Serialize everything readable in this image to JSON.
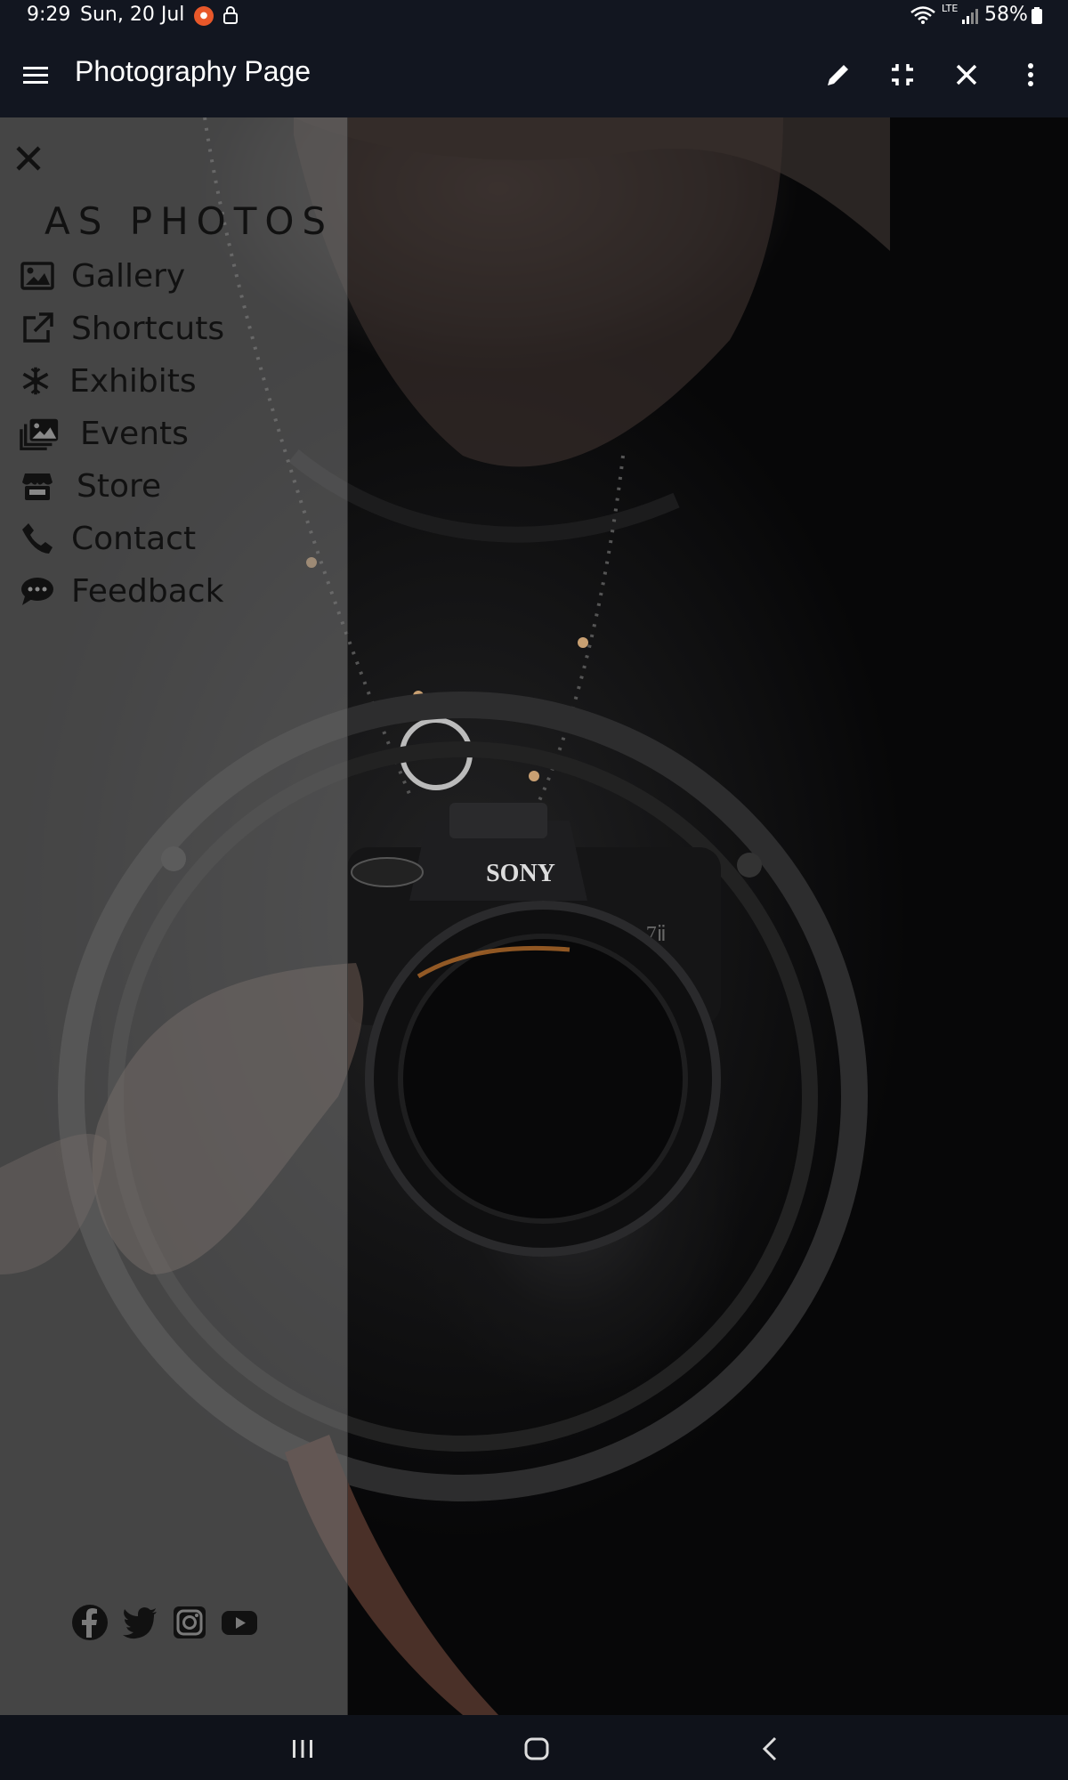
{
  "status_bar": {
    "time": "9:29",
    "date": "Sun, 20 Jul",
    "battery": "58%",
    "network": "LTE"
  },
  "app_bar": {
    "title": "Photography Page",
    "actions": [
      "edit-icon",
      "exit-fullscreen-icon",
      "close-icon",
      "more-vert-icon"
    ]
  },
  "drawer": {
    "brand": "AS PHOTOS",
    "items": [
      {
        "label": "Gallery",
        "icon": "image-icon"
      },
      {
        "label": "Shortcuts",
        "icon": "external-link-icon"
      },
      {
        "label": "Exhibits",
        "icon": "snowflake-icon"
      },
      {
        "label": "Events",
        "icon": "photo-album-icon"
      },
      {
        "label": "Store",
        "icon": "store-icon"
      },
      {
        "label": "Contact",
        "icon": "phone-icon"
      },
      {
        "label": "Feedback",
        "icon": "chat-icon"
      }
    ],
    "social": [
      "facebook-icon",
      "twitter-icon",
      "instagram-icon",
      "youtube-icon"
    ]
  },
  "photo": {
    "camera_brand": "SONY",
    "camera_model": "α 7ⅱ"
  },
  "colors": {
    "bar_background": "#121620",
    "drawer_overlay": "#787878",
    "text_dark": "#111111",
    "accent_orange": "#e8582a"
  }
}
